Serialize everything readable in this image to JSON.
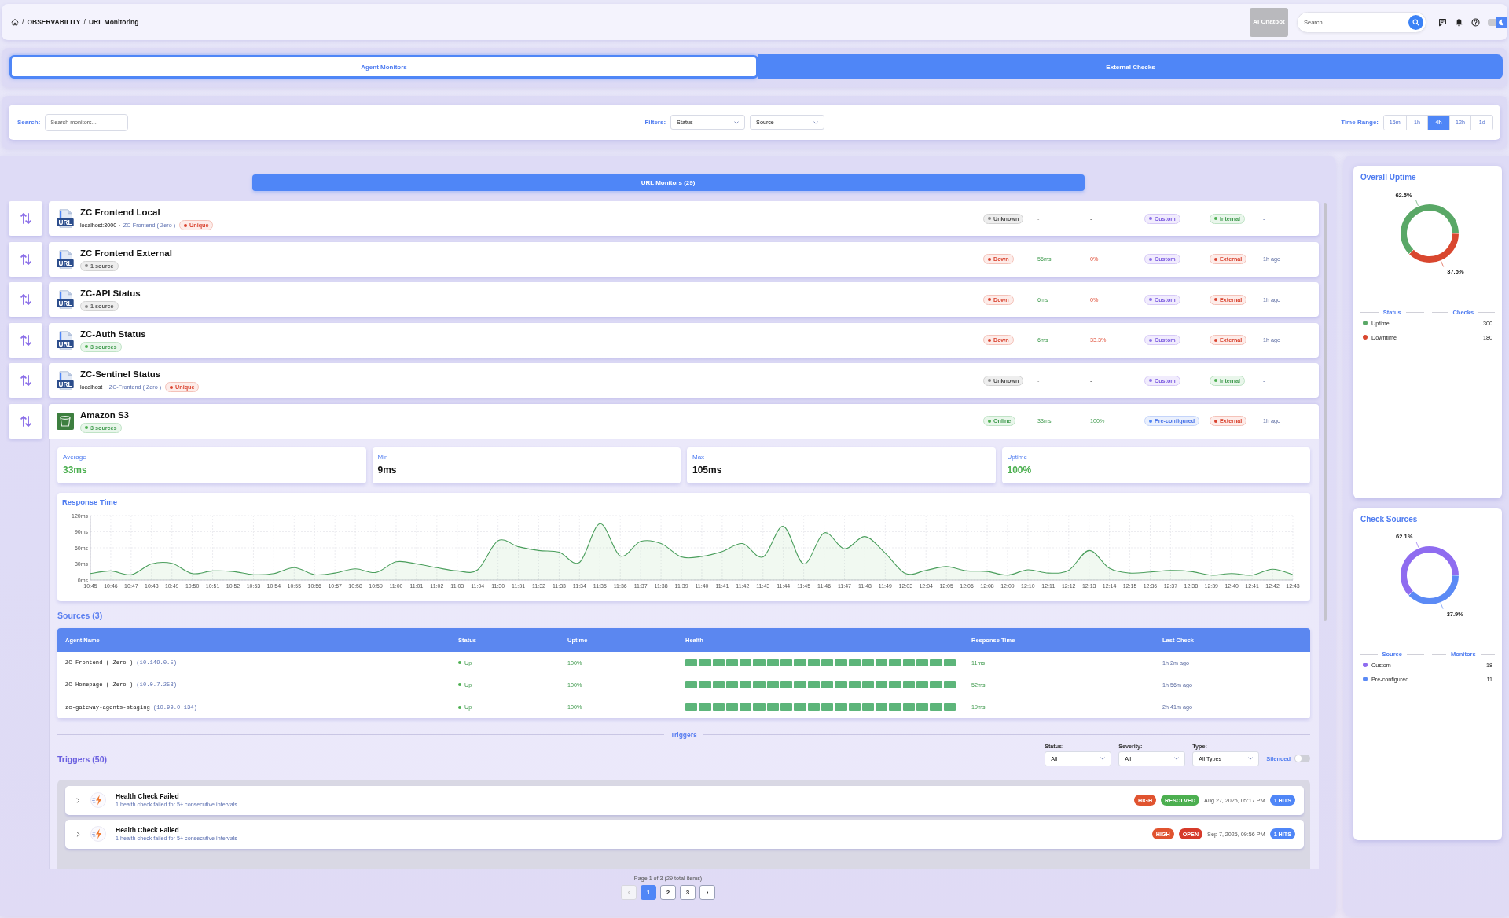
{
  "header": {
    "breadcrumb": [
      {
        "separator": "/",
        "label": "OBSERVABILITY"
      },
      {
        "separator": "/",
        "label": "URL Monitoring"
      }
    ],
    "chatbot_button": "AI Chatbot",
    "search": {
      "placeholder": "Search..."
    },
    "theme_toggle": {
      "on": true
    }
  },
  "tabs": [
    {
      "label": "Agent Monitors",
      "selected": true
    },
    {
      "label": "External Checks",
      "selected": false
    }
  ],
  "filters": {
    "search_label": "Search:",
    "search_placeholder": "Search monitors...",
    "filters_label": "Filters:",
    "selects": [
      "Status",
      "Source"
    ],
    "time_range_label": "Time Range:",
    "time_ranges": [
      {
        "label": "15m",
        "selected": false
      },
      {
        "label": "1h",
        "selected": false
      },
      {
        "label": "4h",
        "selected": true
      },
      {
        "label": "12h",
        "selected": false
      },
      {
        "label": "1d",
        "selected": false
      }
    ]
  },
  "monitors": {
    "title": "URL Monitors (29)",
    "items": [
      {
        "name": "ZC Frontend Local",
        "kind": "url",
        "icon_label": "URL",
        "host": "localhost:3000",
        "separator": "·",
        "agent": "ZC-Frontend ( Zero )",
        "tag": {
          "text": "Unique",
          "kind": "unique"
        },
        "status": {
          "text": "Unknown",
          "kind": "unknown"
        },
        "response": "-",
        "uptime": "-",
        "source": {
          "text": "Custom",
          "kind": "custom"
        },
        "type": {
          "text": "Internal",
          "kind": "internal"
        },
        "last_check": "-",
        "expanded": false
      },
      {
        "name": "ZC Frontend External",
        "kind": "url",
        "icon_label": "URL",
        "tag": {
          "text": "1 source",
          "kind": "single"
        },
        "status": {
          "text": "Down",
          "kind": "down"
        },
        "response": "56ms",
        "uptime": "0%",
        "source": {
          "text": "Custom",
          "kind": "custom"
        },
        "type": {
          "text": "External",
          "kind": "external"
        },
        "last_check": "1h ago",
        "expanded": false
      },
      {
        "name": "ZC-API Status",
        "kind": "url",
        "icon_label": "URL",
        "tag": {
          "text": "1 source",
          "kind": "single"
        },
        "status": {
          "text": "Down",
          "kind": "down"
        },
        "response": "6ms",
        "uptime": "0%",
        "source": {
          "text": "Custom",
          "kind": "custom"
        },
        "type": {
          "text": "External",
          "kind": "external"
        },
        "last_check": "1h ago",
        "expanded": false
      },
      {
        "name": "ZC-Auth Status",
        "kind": "url",
        "icon_label": "URL",
        "tag": {
          "text": "3 sources",
          "kind": "multi"
        },
        "status": {
          "text": "Down",
          "kind": "down"
        },
        "response": "6ms",
        "uptime": "33.3%",
        "source": {
          "text": "Custom",
          "kind": "custom"
        },
        "type": {
          "text": "External",
          "kind": "external"
        },
        "last_check": "1h ago",
        "expanded": false
      },
      {
        "name": "ZC-Sentinel Status",
        "kind": "url",
        "icon_label": "URL",
        "host": "localhost",
        "separator": "·",
        "agent": "ZC-Frontend ( Zero )",
        "tag": {
          "text": "Unique",
          "kind": "unique"
        },
        "status": {
          "text": "Unknown",
          "kind": "unknown"
        },
        "response": "-",
        "uptime": "-",
        "source": {
          "text": "Custom",
          "kind": "custom"
        },
        "type": {
          "text": "Internal",
          "kind": "internal"
        },
        "last_check": "-",
        "expanded": false
      },
      {
        "name": "Amazon S3",
        "kind": "s3",
        "tag": {
          "text": "3 sources",
          "kind": "multi"
        },
        "status": {
          "text": "Online",
          "kind": "online"
        },
        "response": "33ms",
        "uptime": "100%",
        "source": {
          "text": "Pre-configured",
          "kind": "preconfigured"
        },
        "type": {
          "text": "External",
          "kind": "external"
        },
        "last_check": "1h ago",
        "expanded": true,
        "details": {
          "stats": [
            {
              "label": "Average",
              "value": "33ms",
              "color": "#4caf50"
            },
            {
              "label": "Min",
              "value": "9ms",
              "color": "#111111"
            },
            {
              "label": "Max",
              "value": "105ms",
              "color": "#111111"
            },
            {
              "label": "Uptime",
              "value": "100%",
              "color": "#4caf50"
            }
          ],
          "response_chart": {
            "chart_data": {
              "type": "area",
              "title": "Response Time",
              "categories": [
                "10:45",
                "10:46",
                "10:47",
                "10:48",
                "10:49",
                "10:50",
                "10:51",
                "10:52",
                "10:53",
                "10:54",
                "10:55",
                "10:56",
                "10:57",
                "10:58",
                "10:59",
                "11:00",
                "11:01",
                "11:02",
                "11:03",
                "11:04",
                "11:30",
                "11:31",
                "11:32",
                "11:33",
                "11:34",
                "11:35",
                "11:36",
                "11:37",
                "11:38",
                "11:39",
                "11:40",
                "11:41",
                "11:42",
                "11:43",
                "11:44",
                "11:45",
                "11:46",
                "11:47",
                "11:48",
                "11:49",
                "12:03",
                "12:04",
                "12:05",
                "12:06",
                "12:08",
                "12:09",
                "12:10",
                "12:11",
                "12:12",
                "12:13",
                "12:14",
                "12:15",
                "12:36",
                "12:37",
                "12:38",
                "12:39",
                "12:40",
                "12:41",
                "12:42",
                "12:43"
              ],
              "values": [
                12,
                17,
                10,
                30,
                31,
                12,
                17,
                16,
                10,
                12,
                23,
                10,
                13,
                21,
                14,
                34,
                30,
                23,
                17,
                19,
                73,
                62,
                55,
                52,
                33,
                105,
                45,
                72,
                68,
                43,
                44,
                53,
                68,
                43,
                100,
                30,
                88,
                58,
                81,
                50,
                12,
                18,
                25,
                17,
                16,
                9,
                19,
                13,
                18,
                55,
                22,
                13,
                15,
                18,
                16,
                9,
                12,
                9,
                20,
                10
              ],
              "ylim": [
                0,
                120
              ],
              "yticks": [
                {
                  "value": 0,
                  "label": "0ms"
                },
                {
                  "value": 30,
                  "label": "30ms"
                },
                {
                  "value": 60,
                  "label": "60ms"
                },
                {
                  "value": 90,
                  "label": "90ms"
                },
                {
                  "value": 120,
                  "label": "120ms"
                }
              ],
              "grid": true
            }
          },
          "sources": {
            "title": "Sources (3)",
            "columns": [
              "Agent Name",
              "Status",
              "Uptime",
              "Health",
              "Response Time",
              "Last Check"
            ],
            "rows": [
              {
                "agent": "ZC-Frontend ( Zero )",
                "address": "(10.149.0.5)",
                "status": {
                  "text": "Up",
                  "kind": "up"
                },
                "uptime": "100%",
                "health": [
                  true,
                  true,
                  true,
                  true,
                  true,
                  true,
                  true,
                  true,
                  true,
                  true,
                  true,
                  true,
                  true,
                  true,
                  true,
                  true,
                  true,
                  true,
                  true,
                  true
                ],
                "response": "11ms",
                "last_check": "1h 2m ago"
              },
              {
                "agent": "ZC-Homepage ( Zero )",
                "address": "(10.0.7.253)",
                "status": {
                  "text": "Up",
                  "kind": "up"
                },
                "uptime": "100%",
                "health": [
                  true,
                  true,
                  true,
                  true,
                  true,
                  true,
                  true,
                  true,
                  true,
                  true,
                  true,
                  true,
                  true,
                  true,
                  true,
                  true,
                  true,
                  true,
                  true,
                  true
                ],
                "response": "52ms",
                "last_check": "1h 56m ago"
              },
              {
                "agent": "zc-gateway-agents-staging",
                "address": "(10.99.0.134)",
                "status": {
                  "text": "Up",
                  "kind": "up"
                },
                "uptime": "100%",
                "health": [
                  true,
                  true,
                  true,
                  true,
                  true,
                  true,
                  true,
                  true,
                  true,
                  true,
                  true,
                  true,
                  true,
                  true,
                  true,
                  true,
                  true,
                  true,
                  true,
                  true
                ],
                "response": "19ms",
                "last_check": "2h 41m ago"
              }
            ]
          },
          "triggers": {
            "divider": "Triggers",
            "title": "Triggers (50)",
            "filters": [
              {
                "label": "Status:",
                "value": "All"
              },
              {
                "label": "Severity:",
                "value": "All"
              },
              {
                "label": "Type:",
                "value": "All Types"
              }
            ],
            "silenced": {
              "label": "Silenced",
              "on": false
            },
            "items": [
              {
                "title": "Health Check Failed",
                "description": "1 health check failed for 5+ consecutive intervals",
                "severity": {
                  "text": "HIGH",
                  "kind": "high"
                },
                "state": {
                  "text": "RESOLVED",
                  "kind": "resolved"
                },
                "time": "Aug 27, 2025, 05:17 PM",
                "hits": "1 HITS",
                "expanded": false
              },
              {
                "title": "Health Check Failed",
                "description": "1 health check failed for 5+ consecutive intervals",
                "severity": {
                  "text": "HIGH",
                  "kind": "high"
                },
                "state": {
                  "text": "OPEN",
                  "kind": "open"
                },
                "time": "Sep 7, 2025, 09:56 PM",
                "hits": "1 HITS",
                "expanded": false
              }
            ]
          }
        }
      }
    ],
    "pagination": {
      "summary": "Page 1 of 3 (29 total items)",
      "prev": {
        "text": "‹",
        "disabled": true
      },
      "pages": [
        {
          "label": "1",
          "selected": true
        },
        {
          "label": "2",
          "selected": false
        },
        {
          "label": "3",
          "selected": false
        }
      ],
      "next": {
        "text": "›",
        "disabled": false
      }
    }
  },
  "side_panels": [
    {
      "chart_data": {
        "type": "donut",
        "title": "Overall Uptime",
        "categories": [
          "Uptime",
          "Downtime"
        ],
        "values": [
          62.5,
          37.5
        ],
        "value_labels": [
          "62.5%",
          "37.5%"
        ]
      },
      "legend_headers": [
        "Status",
        "Checks"
      ],
      "legend": [
        {
          "value": "300",
          "color": "#5aa867"
        },
        {
          "value": "180",
          "color": "#d9472f"
        }
      ]
    },
    {
      "chart_data": {
        "type": "donut",
        "title": "Check Sources",
        "categories": [
          "Custom",
          "Pre-configured"
        ],
        "values": [
          62.1,
          37.9
        ],
        "value_labels": [
          "62.1%",
          "37.9%"
        ]
      },
      "legend_headers": [
        "Source",
        "Monitors"
      ],
      "legend": [
        {
          "value": "18",
          "color": "#8f6cf0"
        },
        {
          "value": "11",
          "color": "#5b8af5"
        }
      ]
    }
  ]
}
